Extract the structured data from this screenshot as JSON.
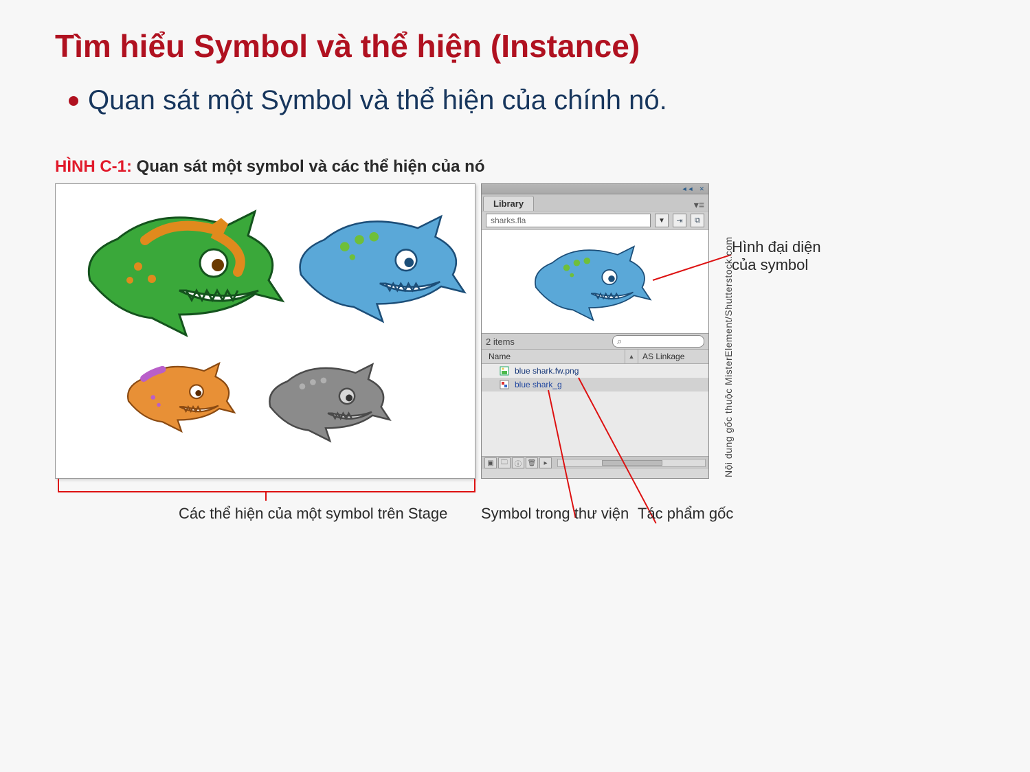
{
  "title": "Tìm hiểu Symbol và thể hiện (Instance)",
  "bullet": "Quan sát một Symbol và thể hiện của chính nó.",
  "figure": {
    "code": "HÌNH C-1:",
    "desc": "Quan sát một symbol và các thể hiện của nó"
  },
  "library": {
    "tab_label": "Library",
    "file_name": "sharks.fla",
    "items_count": "2 items",
    "search_icon": "⌕",
    "col_name": "Name",
    "col_linkage": "AS Linkage",
    "items": [
      {
        "icon": "bitmap",
        "label": "blue shark.fw.png"
      },
      {
        "icon": "graphic",
        "label": "blue shark_g"
      }
    ]
  },
  "annotations": {
    "preview_label_line1": "Hình đại diện",
    "preview_label_line2": "của symbol",
    "stage_label": "Các thể hiện của một symbol trên Stage",
    "symbol_label": "Symbol trong thư viện",
    "artwork_label": "Tác phẩm gốc"
  },
  "credit": "Nội dung gốc thuộc MisterElement/Shutterstock.com"
}
